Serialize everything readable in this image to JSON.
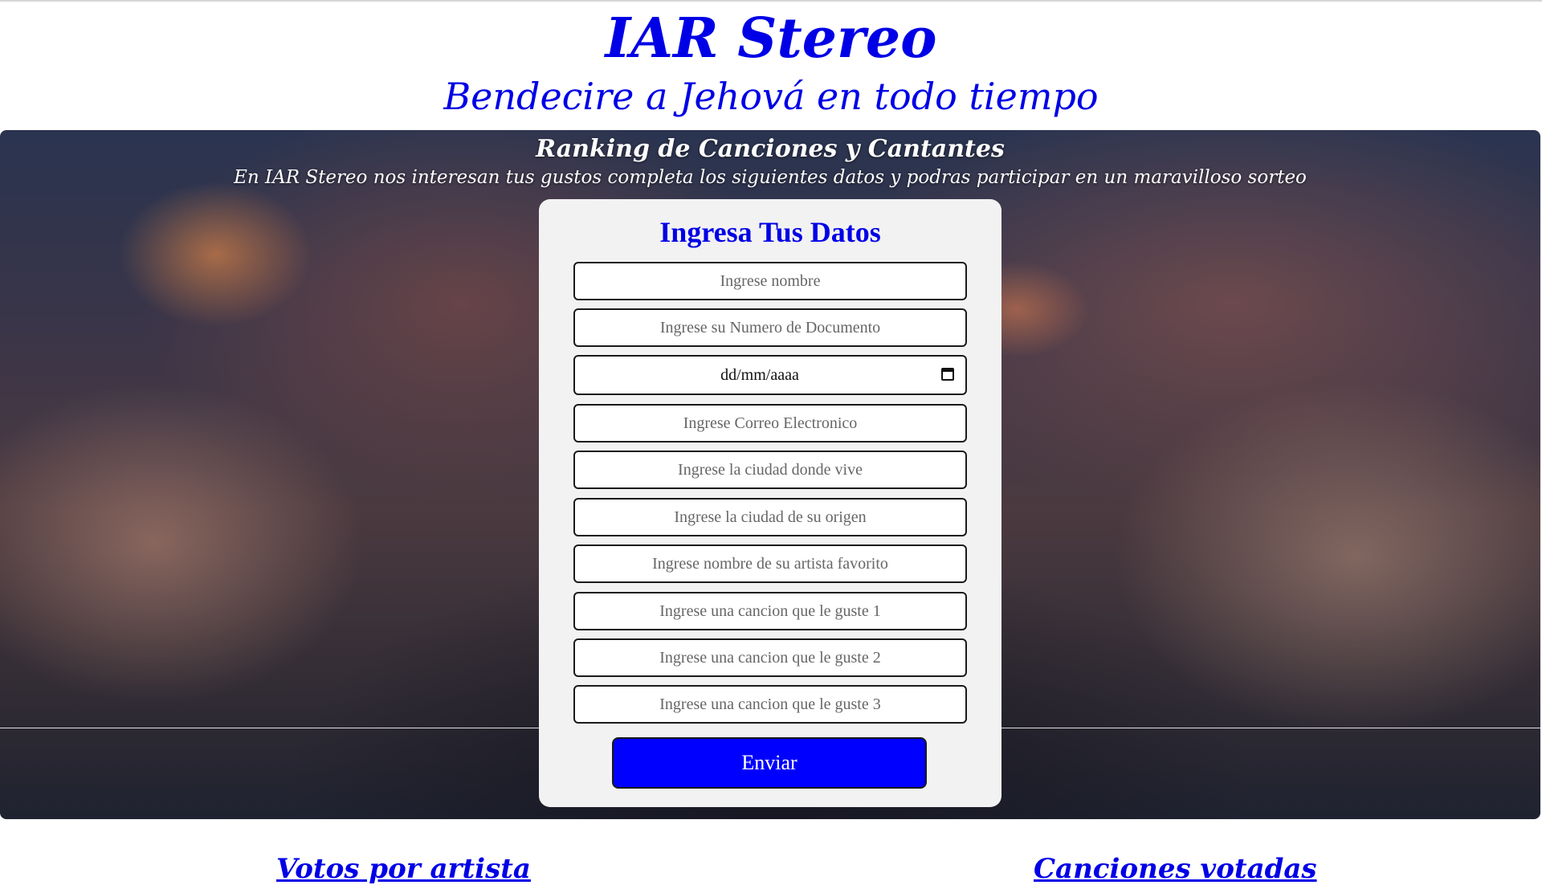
{
  "header": {
    "title": "IAR Stereo",
    "tagline": "Bendecire a Jehová en todo tiempo"
  },
  "hero": {
    "title": "Ranking de Canciones y Cantantes",
    "subtitle": "En IAR Stereo nos interesan tus gustos completa los siguientes datos y podras participar en un maravilloso sorteo"
  },
  "form": {
    "title": "Ingresa Tus Datos",
    "fields": {
      "nombre": "Ingrese nombre",
      "documento": "Ingrese su Numero de Documento",
      "fecha": "dd/mm/aaaa",
      "correo": "Ingrese Correo Electronico",
      "ciudad_vive": "Ingrese la ciudad donde vive",
      "ciudad_origen": "Ingrese la ciudad de su origen",
      "artista": "Ingrese nombre de su artista favorito",
      "cancion1": "Ingrese una cancion que le guste 1",
      "cancion2": "Ingrese una cancion que le guste 2",
      "cancion3": "Ingrese una cancion que le guste 3"
    },
    "submit_label": "Enviar"
  },
  "sections": {
    "votes_by_artist": "Votos por artista",
    "voted_songs": "Canciones votadas"
  },
  "colors": {
    "accent": "#0000e6",
    "button": "#0000ff",
    "card": "#f2f2f2"
  }
}
